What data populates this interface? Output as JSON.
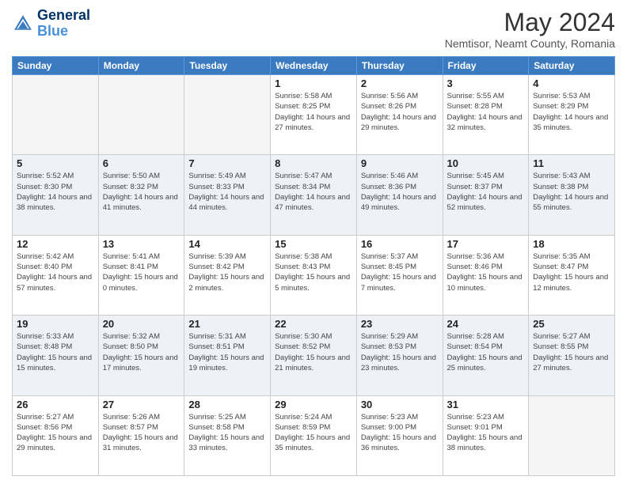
{
  "header": {
    "logo_line1": "General",
    "logo_line2": "Blue",
    "month": "May 2024",
    "location": "Nemtisor, Neamt County, Romania"
  },
  "weekdays": [
    "Sunday",
    "Monday",
    "Tuesday",
    "Wednesday",
    "Thursday",
    "Friday",
    "Saturday"
  ],
  "weeks": [
    [
      {
        "day": "",
        "info": ""
      },
      {
        "day": "",
        "info": ""
      },
      {
        "day": "",
        "info": ""
      },
      {
        "day": "1",
        "info": "Sunrise: 5:58 AM\nSunset: 8:25 PM\nDaylight: 14 hours and 27 minutes."
      },
      {
        "day": "2",
        "info": "Sunrise: 5:56 AM\nSunset: 8:26 PM\nDaylight: 14 hours and 29 minutes."
      },
      {
        "day": "3",
        "info": "Sunrise: 5:55 AM\nSunset: 8:28 PM\nDaylight: 14 hours and 32 minutes."
      },
      {
        "day": "4",
        "info": "Sunrise: 5:53 AM\nSunset: 8:29 PM\nDaylight: 14 hours and 35 minutes."
      }
    ],
    [
      {
        "day": "5",
        "info": "Sunrise: 5:52 AM\nSunset: 8:30 PM\nDaylight: 14 hours and 38 minutes."
      },
      {
        "day": "6",
        "info": "Sunrise: 5:50 AM\nSunset: 8:32 PM\nDaylight: 14 hours and 41 minutes."
      },
      {
        "day": "7",
        "info": "Sunrise: 5:49 AM\nSunset: 8:33 PM\nDaylight: 14 hours and 44 minutes."
      },
      {
        "day": "8",
        "info": "Sunrise: 5:47 AM\nSunset: 8:34 PM\nDaylight: 14 hours and 47 minutes."
      },
      {
        "day": "9",
        "info": "Sunrise: 5:46 AM\nSunset: 8:36 PM\nDaylight: 14 hours and 49 minutes."
      },
      {
        "day": "10",
        "info": "Sunrise: 5:45 AM\nSunset: 8:37 PM\nDaylight: 14 hours and 52 minutes."
      },
      {
        "day": "11",
        "info": "Sunrise: 5:43 AM\nSunset: 8:38 PM\nDaylight: 14 hours and 55 minutes."
      }
    ],
    [
      {
        "day": "12",
        "info": "Sunrise: 5:42 AM\nSunset: 8:40 PM\nDaylight: 14 hours and 57 minutes."
      },
      {
        "day": "13",
        "info": "Sunrise: 5:41 AM\nSunset: 8:41 PM\nDaylight: 15 hours and 0 minutes."
      },
      {
        "day": "14",
        "info": "Sunrise: 5:39 AM\nSunset: 8:42 PM\nDaylight: 15 hours and 2 minutes."
      },
      {
        "day": "15",
        "info": "Sunrise: 5:38 AM\nSunset: 8:43 PM\nDaylight: 15 hours and 5 minutes."
      },
      {
        "day": "16",
        "info": "Sunrise: 5:37 AM\nSunset: 8:45 PM\nDaylight: 15 hours and 7 minutes."
      },
      {
        "day": "17",
        "info": "Sunrise: 5:36 AM\nSunset: 8:46 PM\nDaylight: 15 hours and 10 minutes."
      },
      {
        "day": "18",
        "info": "Sunrise: 5:35 AM\nSunset: 8:47 PM\nDaylight: 15 hours and 12 minutes."
      }
    ],
    [
      {
        "day": "19",
        "info": "Sunrise: 5:33 AM\nSunset: 8:48 PM\nDaylight: 15 hours and 15 minutes."
      },
      {
        "day": "20",
        "info": "Sunrise: 5:32 AM\nSunset: 8:50 PM\nDaylight: 15 hours and 17 minutes."
      },
      {
        "day": "21",
        "info": "Sunrise: 5:31 AM\nSunset: 8:51 PM\nDaylight: 15 hours and 19 minutes."
      },
      {
        "day": "22",
        "info": "Sunrise: 5:30 AM\nSunset: 8:52 PM\nDaylight: 15 hours and 21 minutes."
      },
      {
        "day": "23",
        "info": "Sunrise: 5:29 AM\nSunset: 8:53 PM\nDaylight: 15 hours and 23 minutes."
      },
      {
        "day": "24",
        "info": "Sunrise: 5:28 AM\nSunset: 8:54 PM\nDaylight: 15 hours and 25 minutes."
      },
      {
        "day": "25",
        "info": "Sunrise: 5:27 AM\nSunset: 8:55 PM\nDaylight: 15 hours and 27 minutes."
      }
    ],
    [
      {
        "day": "26",
        "info": "Sunrise: 5:27 AM\nSunset: 8:56 PM\nDaylight: 15 hours and 29 minutes."
      },
      {
        "day": "27",
        "info": "Sunrise: 5:26 AM\nSunset: 8:57 PM\nDaylight: 15 hours and 31 minutes."
      },
      {
        "day": "28",
        "info": "Sunrise: 5:25 AM\nSunset: 8:58 PM\nDaylight: 15 hours and 33 minutes."
      },
      {
        "day": "29",
        "info": "Sunrise: 5:24 AM\nSunset: 8:59 PM\nDaylight: 15 hours and 35 minutes."
      },
      {
        "day": "30",
        "info": "Sunrise: 5:23 AM\nSunset: 9:00 PM\nDaylight: 15 hours and 36 minutes."
      },
      {
        "day": "31",
        "info": "Sunrise: 5:23 AM\nSunset: 9:01 PM\nDaylight: 15 hours and 38 minutes."
      },
      {
        "day": "",
        "info": ""
      }
    ]
  ]
}
